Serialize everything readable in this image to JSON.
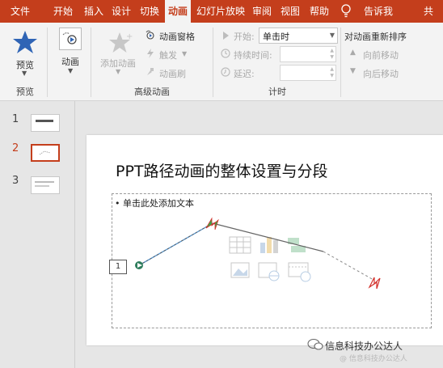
{
  "tabs": [
    "文件",
    "开始",
    "插入",
    "设计",
    "切换",
    "动画",
    "幻灯片放映",
    "审阅",
    "视图",
    "帮助"
  ],
  "active_tab": "动画",
  "tell_me": "告诉我",
  "share": "共",
  "ribbon": {
    "preview": {
      "button": "预览",
      "group": "预览"
    },
    "animation": {
      "button": "动画"
    },
    "advanced": {
      "add_animation": "添加动画",
      "animation_pane": "动画窗格",
      "trigger": "触发",
      "animation_painter": "动画刷",
      "group": "高级动画"
    },
    "timing": {
      "start_label": "开始:",
      "start_value": "单击时",
      "duration_label": "持续时间:",
      "delay_label": "延迟:",
      "group": "计时"
    },
    "reorder": {
      "title": "对动画重新排序",
      "move_earlier": "向前移动",
      "move_later": "向后移动"
    }
  },
  "slides": [
    {
      "number": "1",
      "selected": false
    },
    {
      "number": "2",
      "selected": true
    },
    {
      "number": "3",
      "selected": false
    }
  ],
  "slide": {
    "title": "PPT路径动画的整体设置与分段",
    "placeholder": "• 单击此处添加文本",
    "animation_tag": "1"
  },
  "watermark": {
    "text": "信息科技办公达人",
    "sub": "@ 信息科技办公达人"
  },
  "colors": {
    "accent": "#c43e1c",
    "ribbon_bg": "#f3f3f3",
    "workspace": "#e6e6e6"
  }
}
